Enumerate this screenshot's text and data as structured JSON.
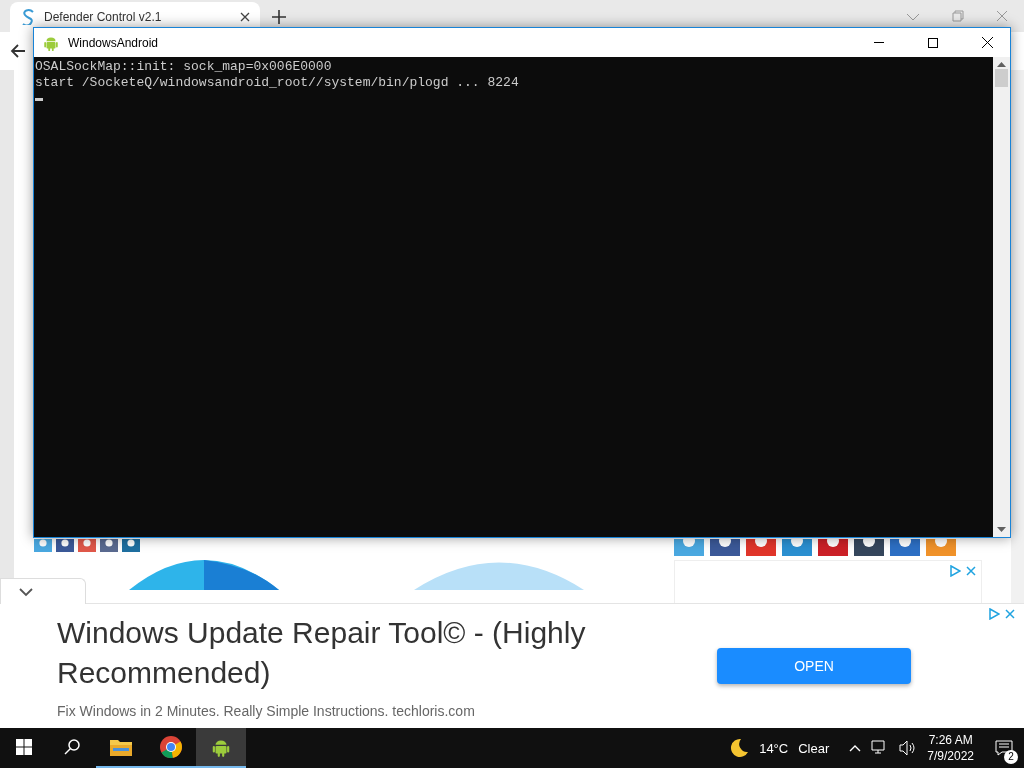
{
  "browser": {
    "tab": {
      "title": "Defender Control v2.1"
    }
  },
  "console": {
    "title": "WindowsAndroid",
    "lines": [
      "OSALSockMap::init: sock_map=0x006E0000",
      "start /SocketeQ/windowsandroid_root//system/bin/plogd ... 8224"
    ]
  },
  "ad_banner": {
    "title": "Windows Update Repair Tool© - (Highly Recommended)",
    "subtitle": "Fix Windows in 2 Minutes. Really Simple Instructions. techloris.com",
    "button": "OPEN"
  },
  "taskbar": {
    "apps": [
      {
        "kind": "explorer",
        "selected": false
      },
      {
        "kind": "chrome",
        "selected": false
      },
      {
        "kind": "android",
        "selected": true
      }
    ],
    "weather": {
      "temperature": "14°C",
      "condition": "Clear"
    },
    "clock": {
      "time": "7:26 AM",
      "date": "7/9/2022"
    },
    "notifications": {
      "count": "2"
    }
  }
}
